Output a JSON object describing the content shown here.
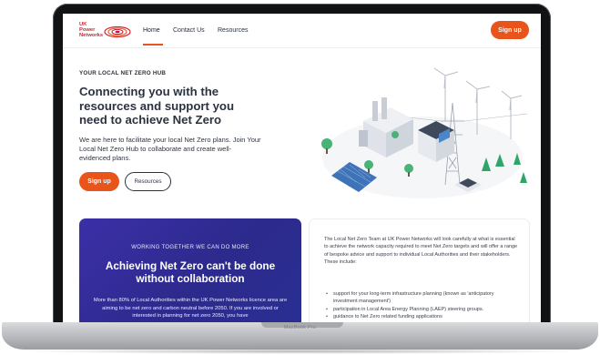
{
  "device": {
    "label": "MacBook Pro"
  },
  "brand": {
    "logo_text": "UK\nPower\nNetworks",
    "accent": "#e9541a",
    "logo_red": "#d8232a"
  },
  "nav": {
    "links": [
      "Home",
      "Contact Us",
      "Resources"
    ],
    "active": "Home",
    "signup_label": "Sign up"
  },
  "hero": {
    "eyebrow": "YOUR LOCAL NET ZERO HUB",
    "title": "Connecting you with the resources and support you need to achieve Net Zero",
    "body": "We are here to facilitate your local Net Zero plans. Join Your Local Net Zero Hub to collaborate and create well-evidenced plans.",
    "signup_label": "Sign up",
    "resources_label": "Resources"
  },
  "collab_card": {
    "eyebrow": "WORKING TOGETHER WE CAN DO MORE",
    "title": "Achieving Net Zero can't be done without collaboration",
    "body": "More than 80% of Local Authorities within the UK Power Networks licence area are aiming to be net zero and carbon neutral before 2050. If you are involved or interested in planning for net zero 2050, you have"
  },
  "info_card": {
    "intro": "The Local Net Zero Team at UK Power Networks will look carefully at what is essential to achieve the network capacity required to meet Net Zero targets and will offer a range of bespoke advice and support to individual Local Authorities and their stakeholders. These include:",
    "bullets": [
      "support for your long-term infrastructure planning (known as 'anticipatory investment management')",
      "participation in Local Area Energy Planning (LAEP) steering groups.",
      "guidance to Net Zero related funding applications"
    ]
  }
}
